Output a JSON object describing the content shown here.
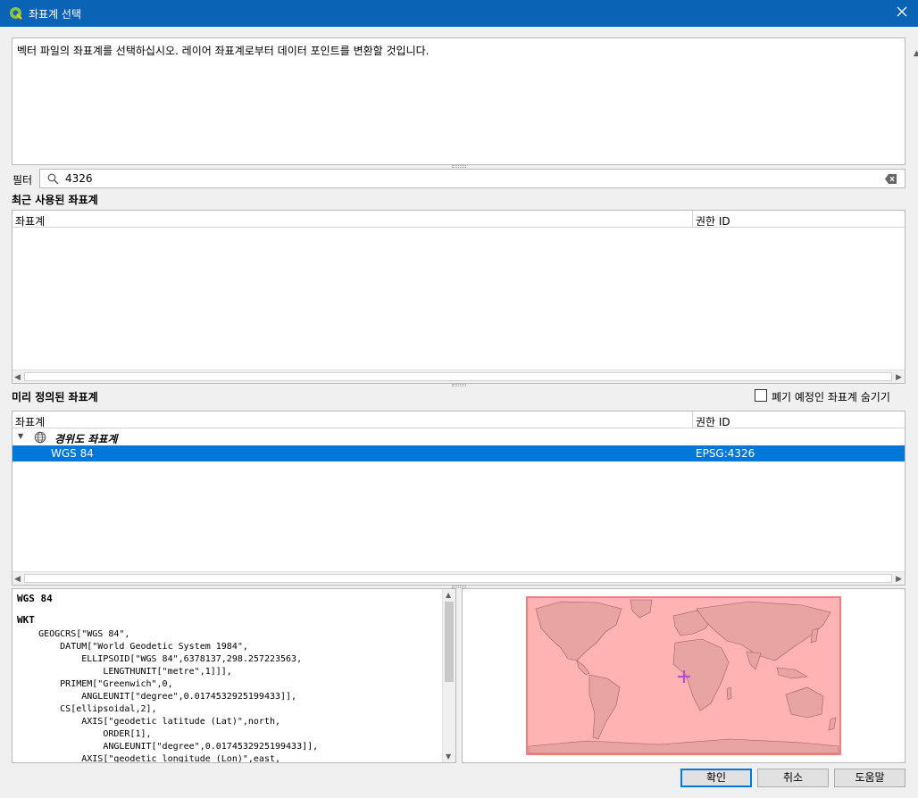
{
  "window": {
    "title": "좌표계 선택"
  },
  "description": "벡터 파일의 좌표계를 선택하십시오. 레이어 좌표계로부터 데이터 포인트를 변환할 것입니다.",
  "filter": {
    "label": "필터",
    "value": "4326"
  },
  "recent": {
    "title": "최근 사용된 좌표계",
    "columns": [
      "좌표계",
      "권한 ID"
    ]
  },
  "predefined": {
    "title": "미리 정의된 좌표계",
    "hide_deprecated_label": "폐기 예정인 좌표계 숨기기",
    "columns": [
      "좌표계",
      "권한 ID"
    ],
    "group": "경위도 좌표계",
    "selected_row": {
      "name": "WGS 84",
      "authid": "EPSG:4326"
    }
  },
  "details": {
    "name": "WGS 84",
    "wkt_label": "WKT",
    "wkt": "    GEOGCRS[\"WGS 84\",\n        DATUM[\"World Geodetic System 1984\",\n            ELLIPSOID[\"WGS 84\",6378137,298.257223563,\n                LENGTHUNIT[\"metre\",1]]],\n        PRIMEM[\"Greenwich\",0,\n            ANGLEUNIT[\"degree\",0.0174532925199433]],\n        CS[ellipsoidal,2],\n            AXIS[\"geodetic latitude (Lat)\",north,\n                ORDER[1],\n                ANGLEUNIT[\"degree\",0.0174532925199433]],\n            AXIS[\"geodetic longitude (Lon)\",east,"
  },
  "buttons": {
    "ok": "확인",
    "cancel": "취소",
    "help": "도움말"
  },
  "colors": {
    "titlebar": "#0b63b5",
    "selection": "#0078d7",
    "extent_fill": "#ffb3b3",
    "extent_border": "#f08080",
    "land": "#e8a3a3",
    "marker": "#b84fd6"
  }
}
